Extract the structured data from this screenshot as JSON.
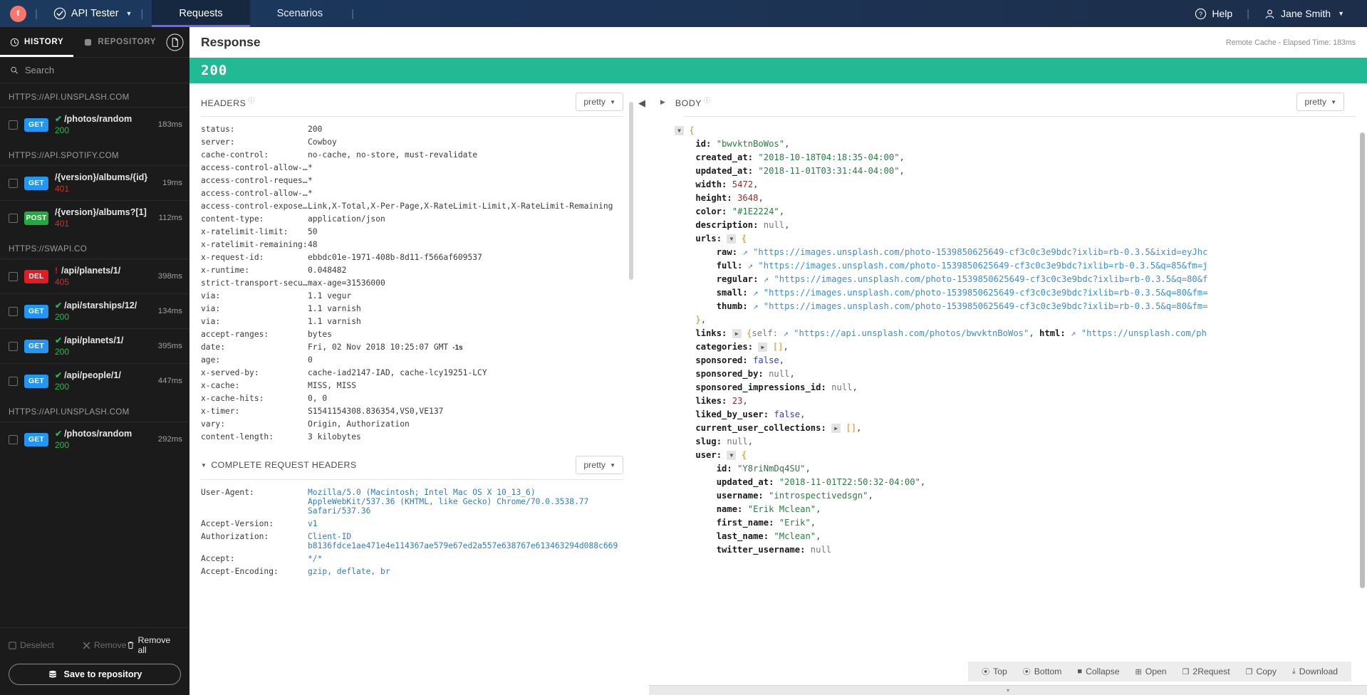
{
  "topbar": {
    "logo_letter": "t",
    "app_name": "API Tester",
    "tabs": [
      {
        "label": "Requests",
        "active": true
      },
      {
        "label": "Scenarios",
        "active": false
      }
    ],
    "help_label": "Help",
    "user_label": "Jane Smith"
  },
  "sidebar": {
    "tabs": [
      {
        "label": "HISTORY",
        "active": true
      },
      {
        "label": "REPOSITORY",
        "active": false
      }
    ],
    "search_placeholder": "Search",
    "groups": [
      {
        "host": "HTTPS://API.UNSPLASH.COM",
        "items": [
          {
            "method": "GET",
            "path": "/photos/random",
            "status": "200",
            "state": "ok",
            "time": "183ms"
          }
        ]
      },
      {
        "host": "HTTPS://API.SPOTIFY.COM",
        "items": [
          {
            "method": "GET",
            "path": "/{version}/albums/{id}",
            "status": "401",
            "state": "err",
            "time": "19ms"
          },
          {
            "method": "POST",
            "path": "/{version}/albums?[1]",
            "status": "401",
            "state": "err",
            "time": "112ms"
          }
        ]
      },
      {
        "host": "HTTPS://SWAPI.CO",
        "items": [
          {
            "method": "DEL",
            "path": "/api/planets/1/",
            "status": "405",
            "state": "warn",
            "time": "398ms"
          },
          {
            "method": "GET",
            "path": "/api/starships/12/",
            "status": "200",
            "state": "ok",
            "time": "134ms"
          },
          {
            "method": "GET",
            "path": "/api/planets/1/",
            "status": "200",
            "state": "ok",
            "time": "395ms"
          },
          {
            "method": "GET",
            "path": "/api/people/1/",
            "status": "200",
            "state": "ok",
            "time": "447ms"
          }
        ]
      },
      {
        "host": "HTTPS://API.UNSPLASH.COM",
        "items": [
          {
            "method": "GET",
            "path": "/photos/random",
            "status": "200",
            "state": "ok",
            "time": "292ms"
          }
        ]
      }
    ],
    "footer": {
      "deselect": "Deselect",
      "remove": "Remove",
      "remove_all": "Remove all",
      "save_to_repository": "Save to repository"
    }
  },
  "response": {
    "title": "Response",
    "meta": "Remote Cache - Elapsed Time: 183ms",
    "status_code": "200",
    "headers_section": {
      "title": "HEADERS",
      "pretty_label": "pretty",
      "rows": [
        {
          "k": "status:",
          "v": "200"
        },
        {
          "k": "server:",
          "v": "Cowboy"
        },
        {
          "k": "cache-control:",
          "v": "no-cache, no-store, must-revalidate"
        },
        {
          "k": "access-control-allow-o…",
          "v": "*"
        },
        {
          "k": "access-control-request…",
          "v": "*"
        },
        {
          "k": "access-control-allow-h…",
          "v": "*"
        },
        {
          "k": "access-control-expose-…",
          "v": "Link,X-Total,X-Per-Page,X-RateLimit-Limit,X-RateLimit-Remaining"
        },
        {
          "k": "content-type:",
          "v": "application/json"
        },
        {
          "k": "x-ratelimit-limit:",
          "v": "50"
        },
        {
          "k": "x-ratelimit-remaining:",
          "v": "48"
        },
        {
          "k": "x-request-id:",
          "v": "ebbdc01e-1971-408b-8d11-f566af609537"
        },
        {
          "k": "x-runtime:",
          "v": "0.048482"
        },
        {
          "k": "strict-transport-secur…",
          "v": "max-age=31536000"
        },
        {
          "k": "via:",
          "v": "1.1 vegur"
        },
        {
          "k": "via:",
          "v": "1.1 varnish"
        },
        {
          "k": "via:",
          "v": "1.1 varnish"
        },
        {
          "k": "accept-ranges:",
          "v": "bytes"
        },
        {
          "k": "date:",
          "v": "Fri, 02 Nov 2018 10:25:07 GMT",
          "badge": "-1s"
        },
        {
          "k": "age:",
          "v": "0"
        },
        {
          "k": "x-served-by:",
          "v": "cache-iad2147-IAD, cache-lcy19251-LCY"
        },
        {
          "k": "x-cache:",
          "v": "MISS, MISS"
        },
        {
          "k": "x-cache-hits:",
          "v": "0, 0"
        },
        {
          "k": "x-timer:",
          "v": "S1541154308.836354,VS0,VE137"
        },
        {
          "k": "vary:",
          "v": "Origin, Authorization"
        },
        {
          "k": "content-length:",
          "v": "3 kilobytes"
        }
      ]
    },
    "request_headers_section": {
      "title": "COMPLETE REQUEST HEADERS",
      "pretty_label": "pretty",
      "rows": [
        {
          "k": "User-Agent:",
          "v": "Mozilla/5.0 (Macintosh; Intel Mac OS X 10_13_6) AppleWebKit/537.36 (KHTML, like Gecko) Chrome/70.0.3538.77 Safari/537.36"
        },
        {
          "k": "Accept-Version:",
          "v": "v1"
        },
        {
          "k": "Authorization:",
          "v": "Client-ID b8136fdce1ae471e4e114367ae579e67ed2a557e638767e613463294d088c669"
        },
        {
          "k": "Accept:",
          "v": "*/*"
        },
        {
          "k": "Accept-Encoding:",
          "v": "gzip, deflate, br"
        }
      ]
    },
    "body_section": {
      "title": "BODY",
      "pretty_label": "pretty",
      "toolbar": [
        {
          "label": "Top",
          "icon": "arrow-up-circle-icon"
        },
        {
          "label": "Bottom",
          "icon": "arrow-down-circle-icon"
        },
        {
          "label": "Collapse",
          "icon": "collapse-icon"
        },
        {
          "label": "Open",
          "icon": "plus-square-icon"
        },
        {
          "label": "2Request",
          "icon": "copy-to-request-icon"
        },
        {
          "label": "Copy",
          "icon": "copy-icon"
        },
        {
          "label": "Download",
          "icon": "download-icon"
        }
      ],
      "json_lines": [
        {
          "indent": 0,
          "toggle": "open",
          "brace": "{"
        },
        {
          "indent": 1,
          "key": "id:",
          "str": "\"bwvktnBoWos\"",
          "comma": true
        },
        {
          "indent": 1,
          "key": "created_at:",
          "str": "\"2018-10-18T04:18:35-04:00\"",
          "comma": true
        },
        {
          "indent": 1,
          "key": "updated_at:",
          "str": "\"2018-11-01T03:31:44-04:00\"",
          "comma": true
        },
        {
          "indent": 1,
          "key": "width:",
          "num": "5472",
          "comma": true
        },
        {
          "indent": 1,
          "key": "height:",
          "num": "3648",
          "comma": true
        },
        {
          "indent": 1,
          "key": "color:",
          "str": "\"#1E2224\"",
          "comma": true
        },
        {
          "indent": 1,
          "key": "description:",
          "null": "null",
          "comma": true
        },
        {
          "indent": 1,
          "key": "urls:",
          "toggle": "open",
          "brace": "{"
        },
        {
          "indent": 2,
          "key": "raw:",
          "link": "\"https://images.unsplash.com/photo-1539850625649-cf3c0c3e9bdc?ixlib=rb-0.3.5&ixid=eyJhc"
        },
        {
          "indent": 2,
          "key": "full:",
          "link": "\"https://images.unsplash.com/photo-1539850625649-cf3c0c3e9bdc?ixlib=rb-0.3.5&q=85&fm=j"
        },
        {
          "indent": 2,
          "key": "regular:",
          "link": "\"https://images.unsplash.com/photo-1539850625649-cf3c0c3e9bdc?ixlib=rb-0.3.5&q=80&f"
        },
        {
          "indent": 2,
          "key": "small:",
          "link": "\"https://images.unsplash.com/photo-1539850625649-cf3c0c3e9bdc?ixlib=rb-0.3.5&q=80&fm="
        },
        {
          "indent": 2,
          "key": "thumb:",
          "link": "\"https://images.unsplash.com/photo-1539850625649-cf3c0c3e9bdc?ixlib=rb-0.3.5&q=80&fm="
        },
        {
          "indent": 1,
          "brace": "}",
          "comma": true
        },
        {
          "indent": 1,
          "key": "links:",
          "toggle": "closed",
          "inline_obj": "{self:",
          "link2": "\"https://api.unsplash.com/photos/bwvktnBoWos\"",
          "tail_key": "html:",
          "link3": "\"https://unsplash.com/ph"
        },
        {
          "indent": 1,
          "key": "categories:",
          "toggle": "closed",
          "arr": "[]",
          "comma": true
        },
        {
          "indent": 1,
          "key": "sponsored:",
          "bool": "false",
          "comma": true
        },
        {
          "indent": 1,
          "key": "sponsored_by:",
          "null": "null",
          "comma": true
        },
        {
          "indent": 1,
          "key": "sponsored_impressions_id:",
          "null": "null",
          "comma": true
        },
        {
          "indent": 1,
          "key": "likes:",
          "num": "23",
          "comma": true
        },
        {
          "indent": 1,
          "key": "liked_by_user:",
          "bool": "false",
          "comma": true
        },
        {
          "indent": 1,
          "key": "current_user_collections:",
          "toggle": "closed",
          "arr": "[]",
          "comma": true
        },
        {
          "indent": 1,
          "key": "slug:",
          "null": "null",
          "comma": true
        },
        {
          "indent": 1,
          "key": "user:",
          "toggle": "open",
          "brace": "{"
        },
        {
          "indent": 2,
          "key": "id:",
          "str": "\"Y8riNmDq4SU\"",
          "comma": true
        },
        {
          "indent": 2,
          "key": "updated_at:",
          "str": "\"2018-11-01T22:50:32-04:00\"",
          "comma": true
        },
        {
          "indent": 2,
          "key": "username:",
          "str": "\"introspectivedsgn\"",
          "comma": true
        },
        {
          "indent": 2,
          "key": "name:",
          "str": "\"Erik Mclean\"",
          "comma": true
        },
        {
          "indent": 2,
          "key": "first_name:",
          "str": "\"Erik\"",
          "comma": true
        },
        {
          "indent": 2,
          "key": "last_name:",
          "str": "\"Mclean\"",
          "comma": true
        },
        {
          "indent": 2,
          "key": "twitter_username:",
          "null": "null",
          "comma": false
        }
      ]
    }
  }
}
